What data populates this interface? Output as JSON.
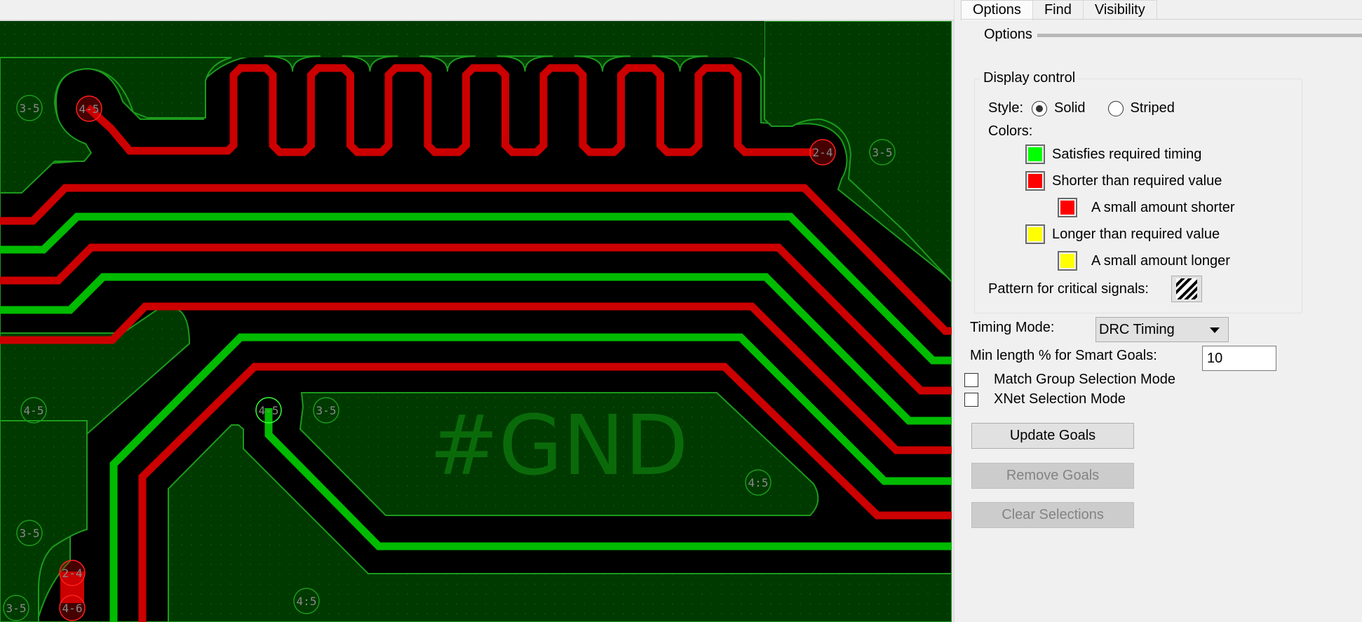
{
  "tabs": [
    {
      "label": "Options",
      "active": true
    },
    {
      "label": "Find",
      "active": false
    },
    {
      "label": "Visibility",
      "active": false
    }
  ],
  "section_title": "Options",
  "display_control": {
    "legend": "Display control",
    "style_label": "Style:",
    "style_options": [
      {
        "label": "Solid",
        "checked": true
      },
      {
        "label": "Striped",
        "checked": false
      }
    ],
    "colors_label": "Colors:",
    "colors": [
      {
        "label": "Satisfies required timing",
        "color": "#00ff00",
        "indent": false
      },
      {
        "label": "Shorter than required value",
        "color": "#ff0000",
        "indent": false
      },
      {
        "label": "A small amount shorter",
        "color": "#ff0000",
        "indent": true
      },
      {
        "label": "Longer than required value",
        "color": "#ffff00",
        "indent": false
      },
      {
        "label": "A small amount longer",
        "color": "#ffff00",
        "indent": true
      }
    ],
    "pattern_label": "Pattern for critical signals:",
    "pattern_icon": "diagonal-stripes-icon"
  },
  "timing_mode": {
    "label": "Timing Mode:",
    "value": "DRC Timing"
  },
  "min_length": {
    "label": "Min length % for Smart Goals:",
    "value": "10"
  },
  "checkboxes": [
    {
      "label": "Match Group Selection Mode",
      "checked": false
    },
    {
      "label": "XNet Selection Mode",
      "checked": false
    }
  ],
  "buttons": [
    {
      "label": "Update Goals",
      "enabled": true
    },
    {
      "label": "Remove Goals",
      "enabled": false
    },
    {
      "label": "Clear Selections",
      "enabled": false
    }
  ],
  "pcb": {
    "plane_label": "#GND",
    "colors": {
      "plane": "#003a00",
      "plane_outline": "#1c9a1c",
      "clearance": "#000000",
      "trace_short": "#cc0000",
      "trace_ok": "#00bb00",
      "via_label": "#8a8a8a"
    },
    "via_labels": [
      "3-5",
      "4-5",
      "2-4",
      "3-5",
      "4-5",
      "3-5",
      "3-5",
      "4:5",
      "4:5",
      "3-5",
      "2-4",
      "4-6",
      "4:5"
    ]
  }
}
